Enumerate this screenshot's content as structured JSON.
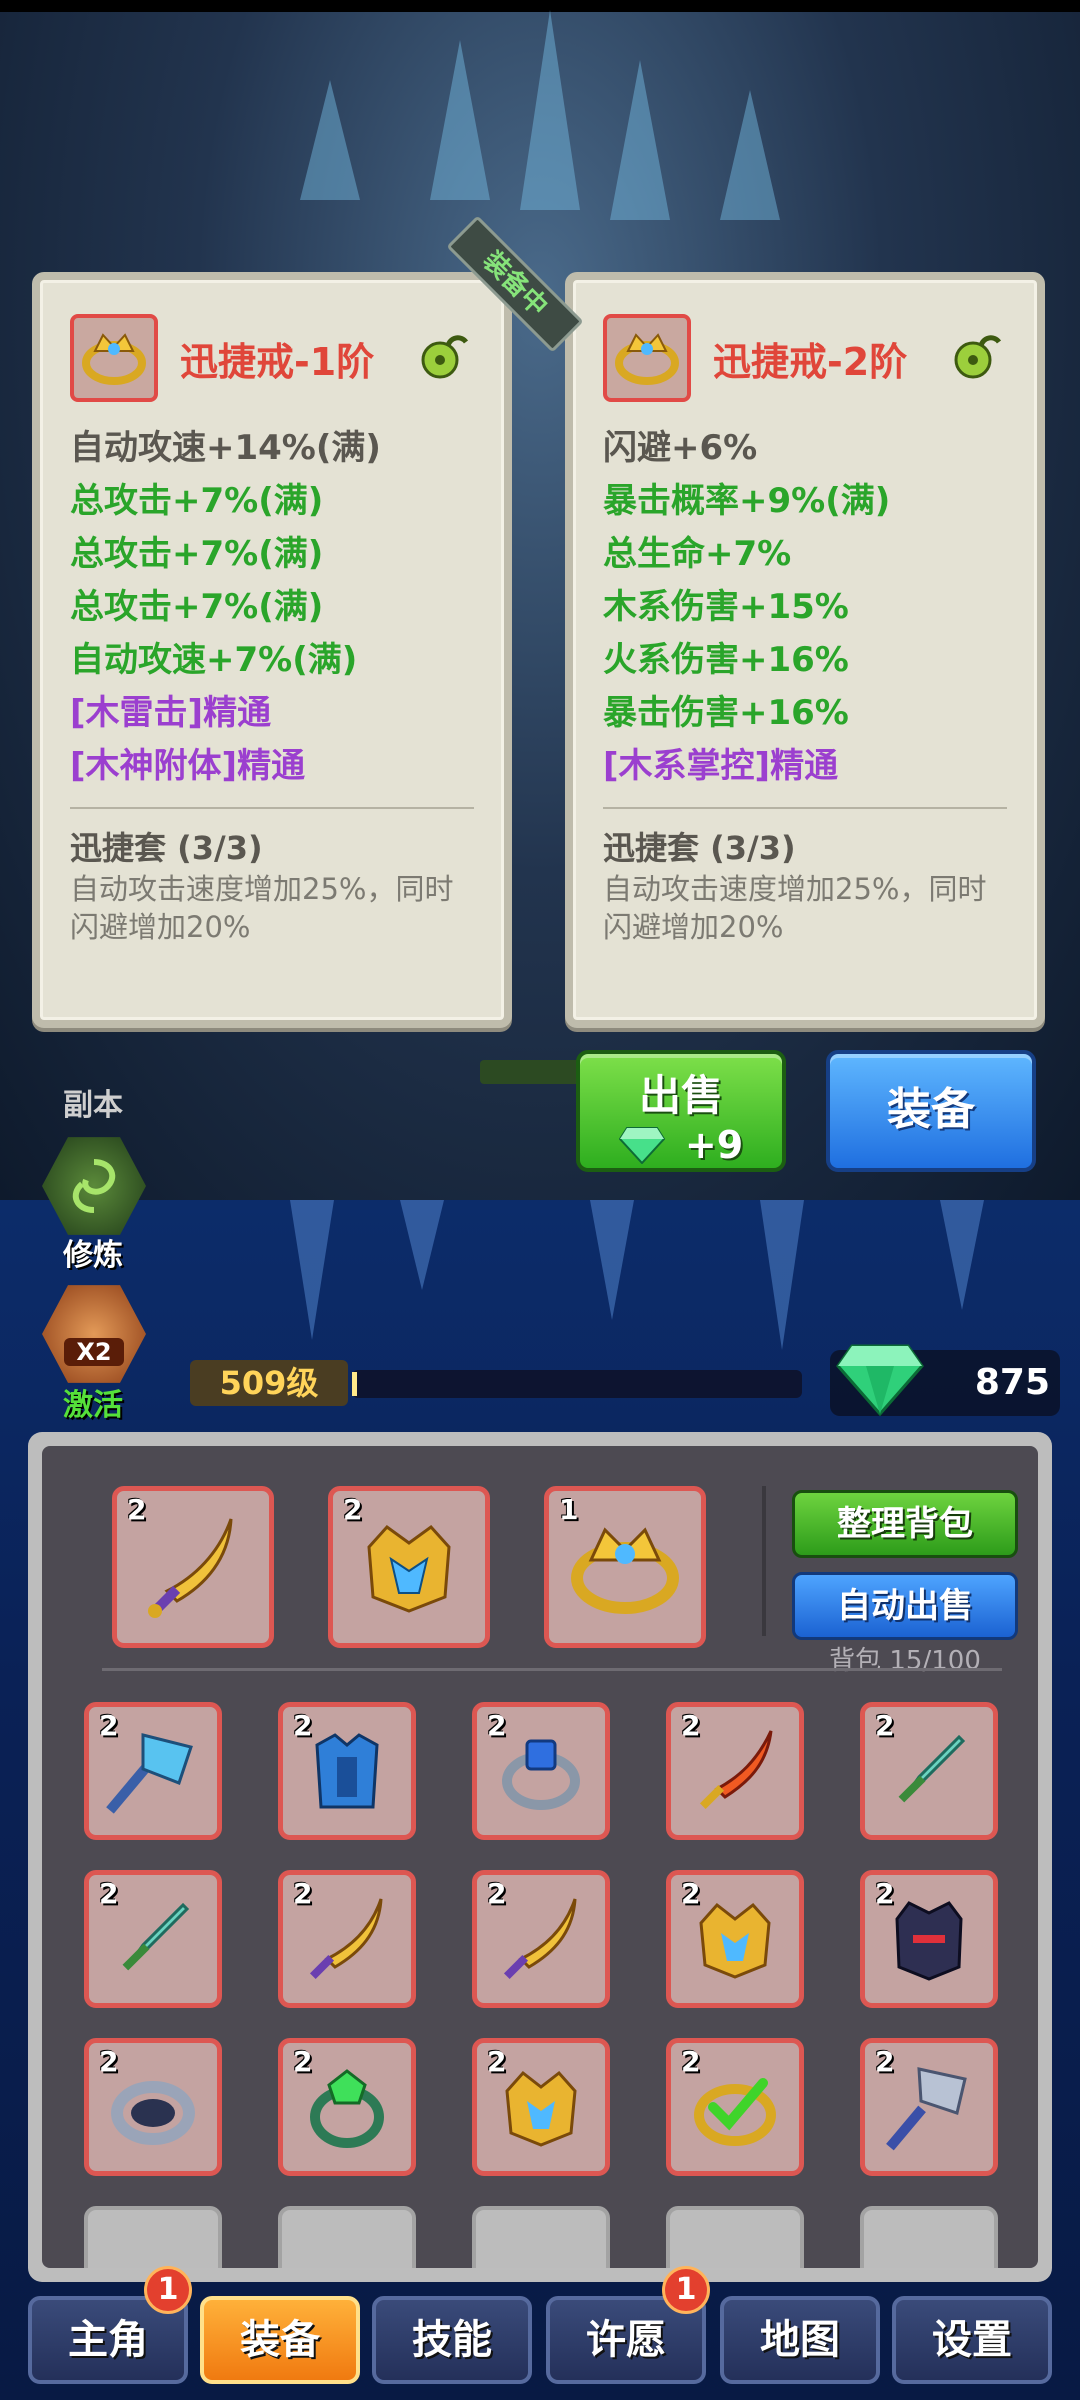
{
  "cards": [
    {
      "title": "迅捷戒-1阶",
      "attrs": [
        {
          "text": "自动攻速+14%(满)",
          "color": "gray"
        },
        {
          "text": "总攻击+7%(满)",
          "color": "green"
        },
        {
          "text": "总攻击+7%(满)",
          "color": "green"
        },
        {
          "text": "总攻击+7%(满)",
          "color": "green"
        },
        {
          "text": "自动攻速+7%(满)",
          "color": "green"
        },
        {
          "text": "[木雷击]精通",
          "color": "purple"
        },
        {
          "text": "[木神附体]精通",
          "color": "purple"
        }
      ],
      "set_title": "迅捷套 (3/3)",
      "set_desc_1": "自动攻击速度增加25%，同时",
      "set_desc_2": "闪避增加20%"
    },
    {
      "title": "迅捷戒-2阶",
      "attrs": [
        {
          "text": "闪避+6%",
          "color": "gray"
        },
        {
          "text": "暴击概率+9%(满)",
          "color": "green"
        },
        {
          "text": "总生命+7%",
          "color": "green"
        },
        {
          "text": "木系伤害+15%",
          "color": "green"
        },
        {
          "text": "火系伤害+16%",
          "color": "green"
        },
        {
          "text": "暴击伤害+16%",
          "color": "green"
        },
        {
          "text": "[木系掌控]精通",
          "color": "purple"
        }
      ],
      "set_title": "迅捷套 (3/3)",
      "set_desc_1": "自动攻击速度增加25%，同时",
      "set_desc_2": "闪避增加20%"
    }
  ],
  "equipped_tag": "装备中",
  "actions": {
    "sell_label": "出售",
    "sell_reward": "+9",
    "equip_label": "装备"
  },
  "side_menu": {
    "dungeon_label": "副本",
    "cultivate_label": "修炼",
    "activate_label": "激活",
    "activate_multiplier": "X2"
  },
  "status": {
    "level": "509级",
    "level_progress": 0.01,
    "gems": "875"
  },
  "inventory": {
    "sort_label": "整理背包",
    "autosell_label": "自动出售",
    "bag_count": "背包 15/100",
    "top_items": [
      {
        "count": "2",
        "icon": "golden-dagger"
      },
      {
        "count": "2",
        "icon": "golden-helmet"
      },
      {
        "count": "1",
        "icon": "golden-ring"
      }
    ],
    "grid_items": [
      {
        "count": "2",
        "icon": "ice-axe"
      },
      {
        "count": "2",
        "icon": "blue-armor"
      },
      {
        "count": "2",
        "icon": "sapphire-ring"
      },
      {
        "count": "2",
        "icon": "fire-dagger"
      },
      {
        "count": "2",
        "icon": "jade-sword"
      },
      {
        "count": "2",
        "icon": "jade-sword"
      },
      {
        "count": "2",
        "icon": "golden-dagger"
      },
      {
        "count": "2",
        "icon": "golden-dagger"
      },
      {
        "count": "2",
        "icon": "golden-helmet"
      },
      {
        "count": "2",
        "icon": "dark-helmet"
      },
      {
        "count": "2",
        "icon": "silver-ring"
      },
      {
        "count": "2",
        "icon": "emerald-ring"
      },
      {
        "count": "2",
        "icon": "golden-helmet"
      },
      {
        "count": "2",
        "icon": "checked-ring"
      },
      {
        "count": "2",
        "icon": "steel-axe"
      }
    ]
  },
  "nav": [
    {
      "label": "主角",
      "badge": "1"
    },
    {
      "label": "装备",
      "badge": ""
    },
    {
      "label": "技能",
      "badge": ""
    },
    {
      "label": "许愿",
      "badge": "1"
    },
    {
      "label": "地图",
      "badge": ""
    },
    {
      "label": "设置",
      "badge": ""
    }
  ]
}
